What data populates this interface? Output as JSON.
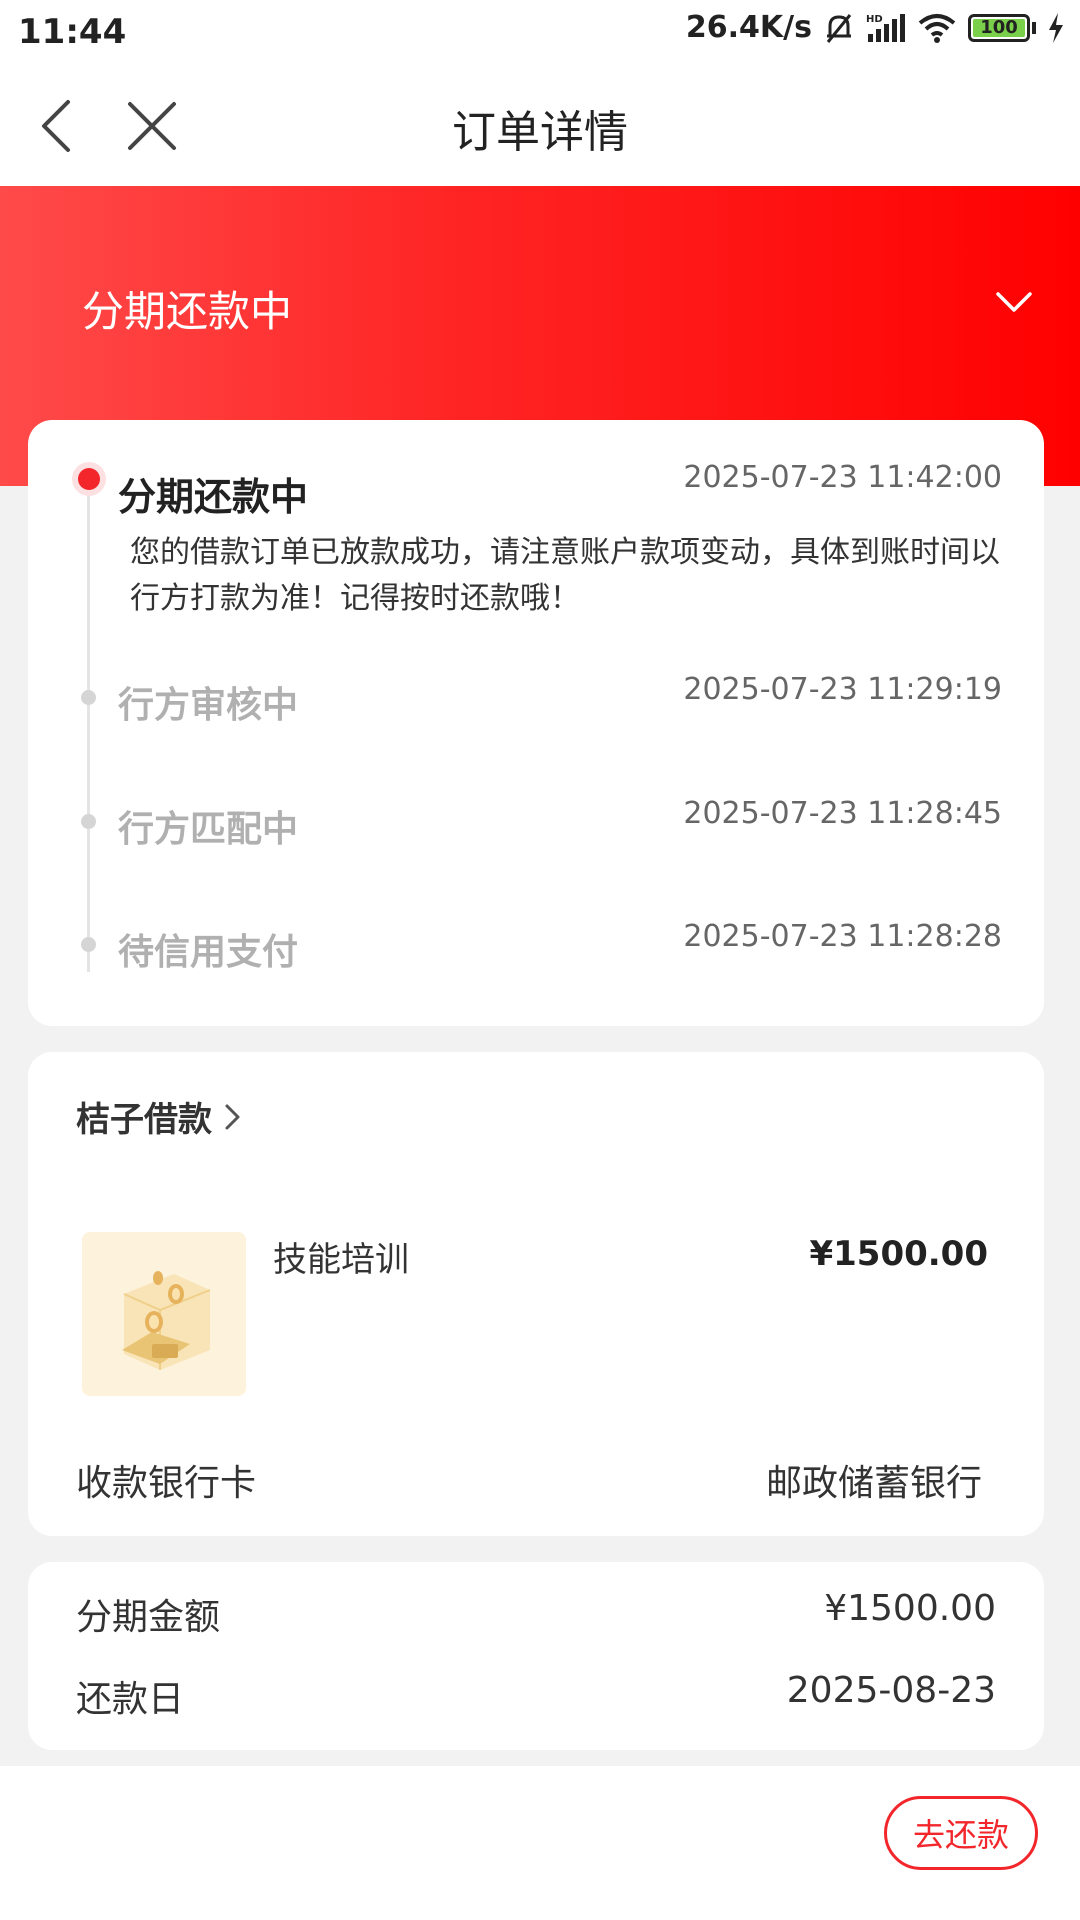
{
  "status_bar": {
    "time": "11:44",
    "network_speed": "26.4K/s",
    "battery": "100",
    "battery_level_percent": 100,
    "icons": [
      "mute-bell-icon",
      "hd-signal-icon",
      "wifi-icon",
      "battery-icon",
      "charging-icon"
    ]
  },
  "nav": {
    "title": "订单详情",
    "back_icon": "chevron-left-icon",
    "close_icon": "close-icon"
  },
  "banner": {
    "title": "分期还款中",
    "expand_icon": "chevron-down-icon"
  },
  "timeline": {
    "current": {
      "title": "分期还款中",
      "time": "2025-07-23 11:42:00",
      "description": "您的借款订单已放款成功，请注意账户款项变动，具体到账时间以行方打款为准！记得按时还款哦！"
    },
    "history": [
      {
        "title": "行方审核中",
        "time": "2025-07-23 11:29:19"
      },
      {
        "title": "行方匹配中",
        "time": "2025-07-23 11:28:45"
      },
      {
        "title": "待信用支付",
        "time": "2025-07-23 11:28:28"
      }
    ]
  },
  "product": {
    "merchant": "桔子借款",
    "name": "技能培训",
    "price": "¥1500.00",
    "bank_label": "收款银行卡",
    "bank_value": "邮政储蓄银行"
  },
  "installment": {
    "amount_label": "分期金额",
    "amount_value": "¥1500.00",
    "due_label": "还款日",
    "due_value": "2025-08-23"
  },
  "actions": {
    "repay_label": "去还款"
  },
  "colors": {
    "accent": "#f2262b",
    "banner_start": "#ff4a4a",
    "banner_end": "#ff0000"
  }
}
